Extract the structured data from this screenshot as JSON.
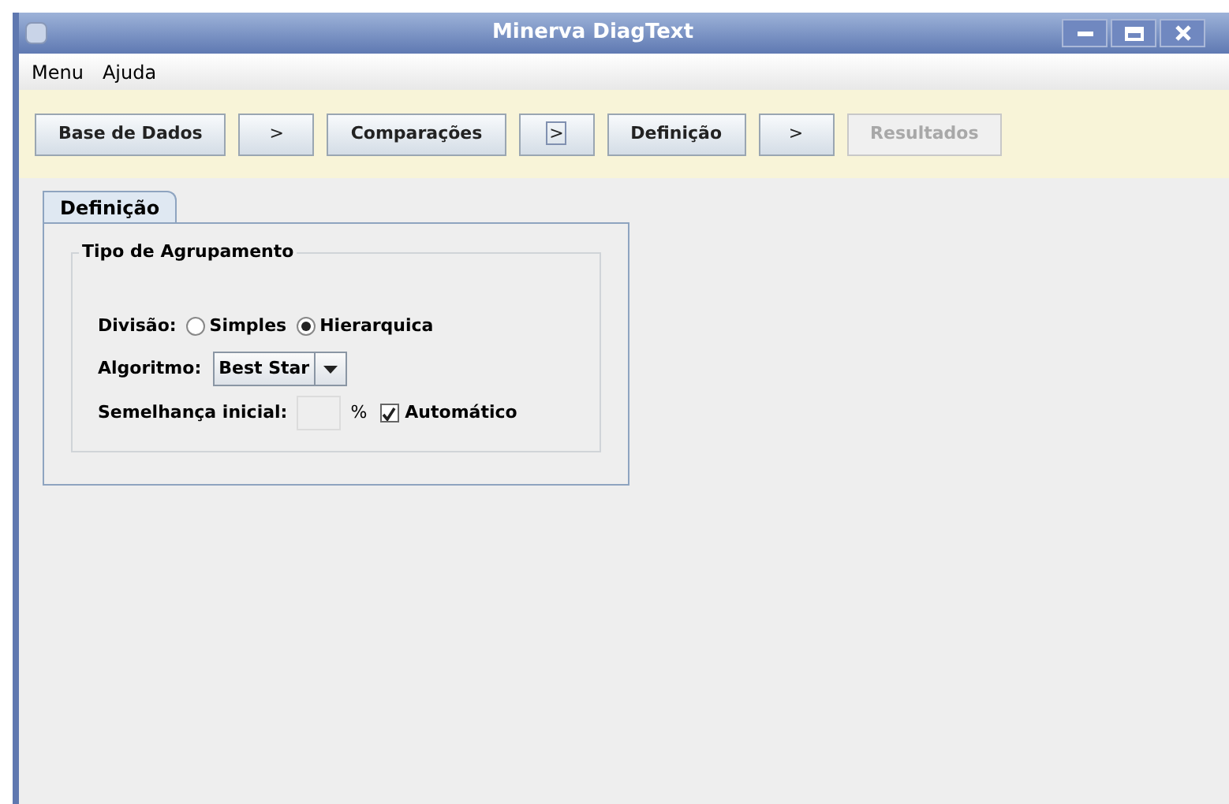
{
  "window": {
    "title": "Minerva DiagText"
  },
  "menu": [
    "Menu",
    "Ajuda"
  ],
  "steps": [
    {
      "kind": "step",
      "label": "Base de Dados",
      "disabled": false,
      "focused": false
    },
    {
      "kind": "arrow",
      "label": ">",
      "disabled": false,
      "focused": false
    },
    {
      "kind": "step",
      "label": "Comparações",
      "disabled": false,
      "focused": false
    },
    {
      "kind": "arrow",
      "label": ">",
      "disabled": false,
      "focused": true
    },
    {
      "kind": "step",
      "label": "Definição",
      "disabled": false,
      "focused": false
    },
    {
      "kind": "arrow",
      "label": ">",
      "disabled": false,
      "focused": false
    },
    {
      "kind": "step",
      "label": "Resultados",
      "disabled": true,
      "focused": false
    }
  ],
  "tabs": [
    {
      "label": "Definição",
      "selected": true
    }
  ],
  "group": {
    "title": "Tipo de Agrupamento",
    "division": {
      "label": "Divisão:",
      "options": [
        {
          "label": "Simples",
          "selected": false
        },
        {
          "label": "Hierarquica",
          "selected": true
        }
      ]
    },
    "algorithm": {
      "label": "Algoritmo:",
      "value": "Best Star"
    },
    "similarity": {
      "label": "Semelhança inicial:",
      "unit": "%",
      "disabled": true,
      "auto": {
        "label": "Automático",
        "checked": true
      }
    }
  }
}
